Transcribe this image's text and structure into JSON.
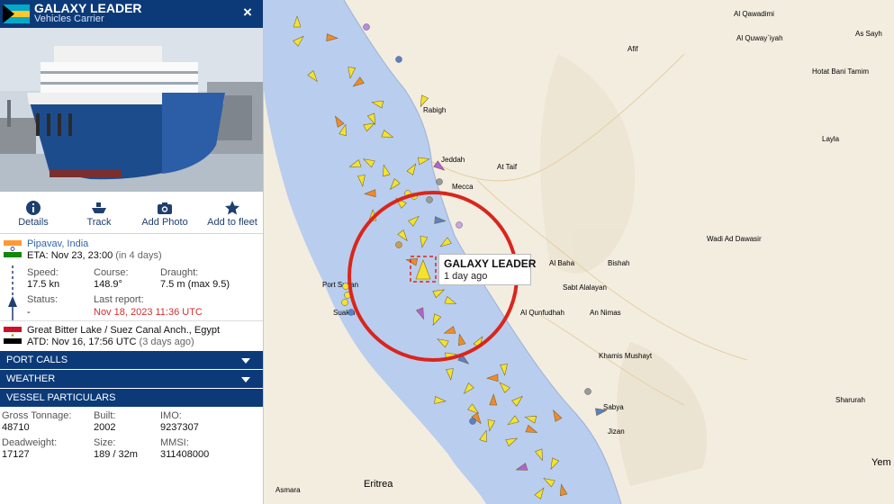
{
  "vessel": {
    "name": "GALAXY LEADER",
    "type": "Vehicles Carrier",
    "flag_icon": "bahamas-flag-icon",
    "close_label": "×"
  },
  "actions": [
    {
      "label": "Details",
      "icon": "info-icon"
    },
    {
      "label": "Track",
      "icon": "ship-icon"
    },
    {
      "label": "Add Photo",
      "icon": "camera-icon"
    },
    {
      "label": "Add to fleet",
      "icon": "star-icon"
    }
  ],
  "destination": {
    "port": "Pipavav, India",
    "eta_label": "ETA:",
    "eta_value": "Nov 23, 23:00",
    "eta_note": "(in 4 days)",
    "flag_icon": "india-flag-icon"
  },
  "voyage": {
    "speed_label": "Speed:",
    "speed_value": "17.5 kn",
    "course_label": "Course:",
    "course_value": "148.9°",
    "draught_label": "Draught:",
    "draught_value": "7.5 m (max 9.5)",
    "status_label": "Status:",
    "status_value": "-",
    "last_report_label": "Last report:",
    "last_report_value": "Nov 18, 2023 11:36 UTC"
  },
  "departure": {
    "port": "Great Bitter Lake / Suez Canal Anch., Egypt",
    "atd_label": "ATD:",
    "atd_value": "Nov 16, 17:56 UTC",
    "atd_note": "(3 days ago)",
    "flag_icon": "egypt-flag-icon"
  },
  "sections": [
    "PORT CALLS",
    "WEATHER",
    "VESSEL PARTICULARS"
  ],
  "particulars": [
    {
      "label": "Gross Tonnage:",
      "value": "48710"
    },
    {
      "label": "Built:",
      "value": "2002"
    },
    {
      "label": "IMO:",
      "value": "9237307"
    },
    {
      "label": "Deadweight:",
      "value": "17127"
    },
    {
      "label": "Size:",
      "value": "189 / 32m"
    },
    {
      "label": "MMSI:",
      "value": "311408000"
    }
  ],
  "popup": {
    "title": "GALAXY LEADER",
    "subtitle": "1 day ago"
  },
  "map_labels": {
    "places": [
      "Al Qawadimi",
      "Al Quway`iyah",
      "Afif",
      "Hotat Bani Tamim",
      "Layla",
      "Jeddah",
      "Mecca",
      "At Taif",
      "Rabigh",
      "Al Baha",
      "Bishah",
      "Sabt Alalayan",
      "Wadi Ad Dawasir",
      "Al Qunfudhah",
      "An Nimas",
      "Khamis Mushayt",
      "Sabya",
      "Jizan",
      "Sharurah",
      "Port Sudan",
      "Suakin",
      "Asmara",
      "As Sayh",
      "Yem"
    ],
    "country": "Eritrea"
  },
  "colors": {
    "header_bg": "#0c3a79",
    "sea": "#b9cdee",
    "land": "#f3ede0",
    "cargo_vessel": "#f4e22e",
    "tanker_vessel": "#f08a2b",
    "other_vessel": "#b062d6",
    "highlight_circle": "#d9261c",
    "last_report": "#d32f2f"
  }
}
